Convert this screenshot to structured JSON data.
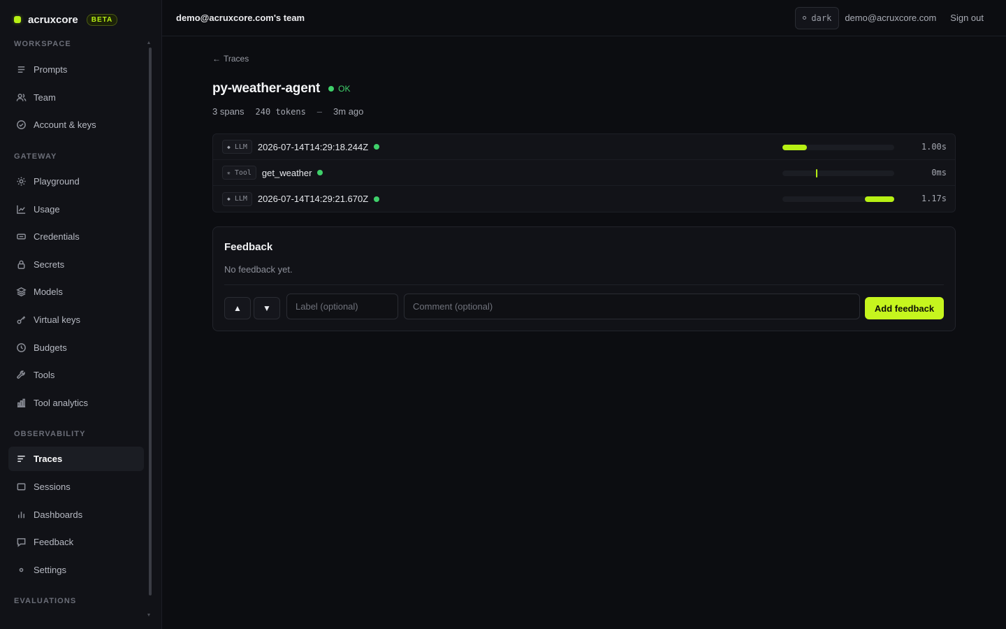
{
  "brand": {
    "name": "acruxcore",
    "badge": "BETA",
    "accent": "#b7f014"
  },
  "sidebar": {
    "sections": [
      {
        "label": "WORKSPACE",
        "items": [
          {
            "label": "Prompts",
            "icon": "list-icon"
          },
          {
            "label": "Team",
            "icon": "users-icon"
          },
          {
            "label": "Account & keys",
            "icon": "check-circle-icon"
          }
        ]
      },
      {
        "label": "GATEWAY",
        "items": [
          {
            "label": "Playground",
            "icon": "sun-icon"
          },
          {
            "label": "Usage",
            "icon": "line-chart-icon"
          },
          {
            "label": "Credentials",
            "icon": "card-icon"
          },
          {
            "label": "Secrets",
            "icon": "lock-icon"
          },
          {
            "label": "Models",
            "icon": "layers-icon"
          },
          {
            "label": "Virtual keys",
            "icon": "key-icon"
          },
          {
            "label": "Budgets",
            "icon": "clock-icon"
          },
          {
            "label": "Tools",
            "icon": "wrench-icon"
          },
          {
            "label": "Tool analytics",
            "icon": "bar-chart-icon"
          }
        ]
      },
      {
        "label": "OBSERVABILITY",
        "items": [
          {
            "label": "Traces",
            "icon": "traces-icon",
            "active": true
          },
          {
            "label": "Sessions",
            "icon": "window-icon"
          },
          {
            "label": "Dashboards",
            "icon": "bars-icon"
          },
          {
            "label": "Feedback",
            "icon": "message-icon"
          },
          {
            "label": "Settings",
            "icon": "dot-icon"
          }
        ]
      },
      {
        "label": "EVALUATIONS",
        "items": []
      }
    ]
  },
  "topbar": {
    "team": "demo@acruxcore.com's team",
    "theme": "dark",
    "user_email": "demo@acruxcore.com",
    "signout": "Sign out"
  },
  "trace": {
    "back_label": "Traces",
    "title": "py-weather-agent",
    "status": "OK",
    "status_color": "#3fd06a",
    "spans_count": "3 spans",
    "tokens": "240 tokens",
    "separator": "–",
    "age": "3m ago",
    "spans": [
      {
        "kind": "LLM",
        "name": "2026-07-14T14:29:18.244Z",
        "duration": "1.00s",
        "bar_start": 0.0,
        "bar_width": 0.22
      },
      {
        "kind": "Tool",
        "name": "get_weather",
        "duration": "0ms",
        "bar_start": 0.3,
        "bar_width": 0
      },
      {
        "kind": "LLM",
        "name": "2026-07-14T14:29:21.670Z",
        "duration": "1.17s",
        "bar_start": 0.74,
        "bar_width": 0.26
      }
    ]
  },
  "feedback": {
    "title": "Feedback",
    "empty": "No feedback yet.",
    "label_placeholder": "Label (optional)",
    "comment_placeholder": "Comment (optional)",
    "submit": "Add feedback"
  }
}
